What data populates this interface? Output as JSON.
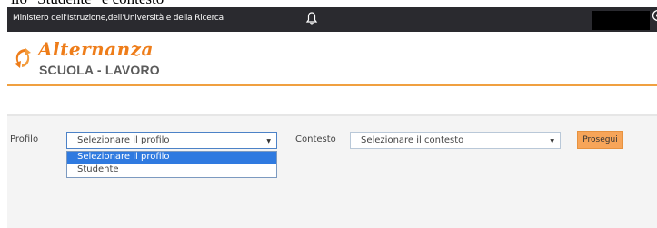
{
  "clipped_caption": "ilo \"Studente\" e contesto",
  "header": {
    "ministry": "Ministero dell'Istruzione,dell'Università e della Ricerca",
    "bell_icon": "bell-icon",
    "globe_icon": "globe-icon"
  },
  "logo": {
    "title": "Alternanza",
    "subtitle": "SCUOLA - LAVORO",
    "mark_icon": "arrows-logo-icon",
    "color": "#ee7d1a"
  },
  "form": {
    "profile_label": "Profilo",
    "profile_value": "Selezionare il profilo",
    "profile_options": [
      "Selezionare il profilo",
      "Studente"
    ],
    "context_label": "Contesto",
    "context_value": "Selezionare il contesto",
    "submit_label": "Prosegui"
  },
  "colors": {
    "accent": "#f7a559",
    "selected": "#2f7ae0",
    "topbar": "#2a2a2f"
  }
}
